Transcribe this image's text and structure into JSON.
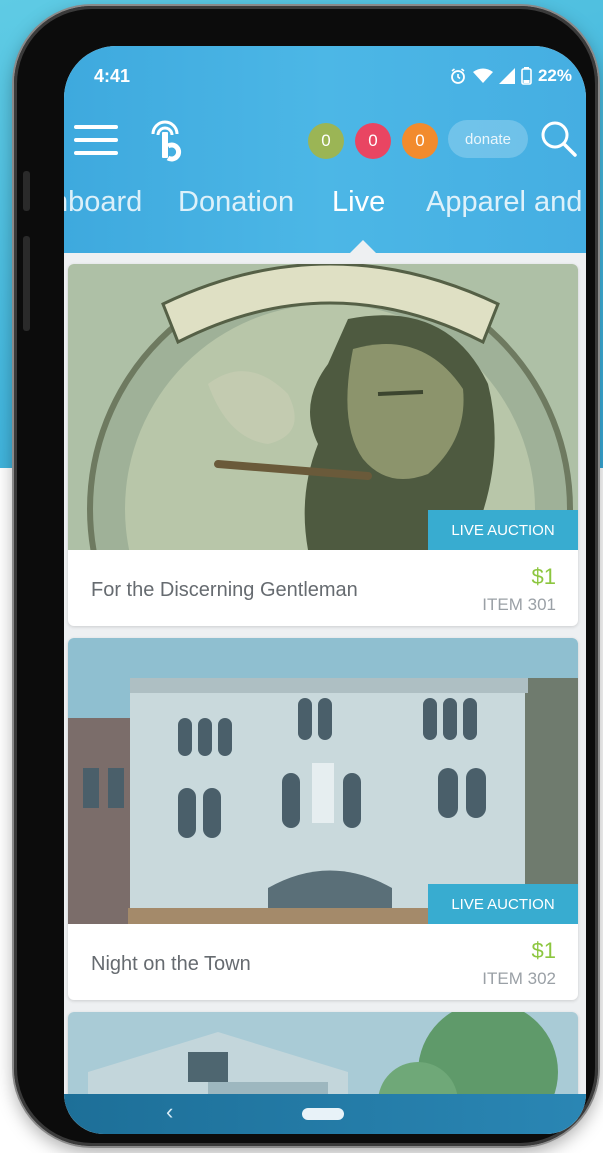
{
  "status_bar": {
    "time": "4:41",
    "battery": "22%"
  },
  "header": {
    "badges": [
      {
        "count": "0",
        "color": "#9bb555"
      },
      {
        "count": "0",
        "color": "#e94562"
      },
      {
        "count": "0",
        "color": "#f28b2d"
      }
    ],
    "donate_label": "donate",
    "icons": {
      "menu": "hamburger-icon",
      "logo": "app-logo",
      "search": "search-icon"
    }
  },
  "tabs": [
    {
      "label": "nboard"
    },
    {
      "label": "Donation"
    },
    {
      "label": "Live",
      "active": true
    },
    {
      "label": "Apparel and"
    }
  ],
  "cards": [
    {
      "title": "For the Discerning Gentleman",
      "tag": "LIVE AUCTION",
      "price": "$1",
      "item": "ITEM 301",
      "image": "Pappy Van Winkle's label portrait"
    },
    {
      "title": "Night on the Town",
      "tag": "LIVE AUCTION",
      "price": "$1",
      "item": "ITEM 302",
      "image": "Fulton theatre building facade"
    },
    {
      "image": "house with trees"
    }
  ],
  "colors": {
    "accent": "#3ea9de",
    "price": "#8cc63f",
    "tag": "#38acd0"
  }
}
